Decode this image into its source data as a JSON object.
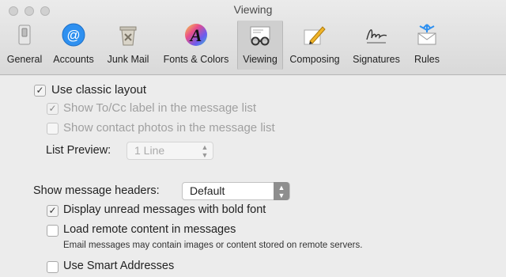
{
  "window": {
    "title": "Viewing"
  },
  "toolbar": {
    "tabs": [
      {
        "label": "General",
        "icon": "general-switch-icon"
      },
      {
        "label": "Accounts",
        "icon": "at-sign-icon"
      },
      {
        "label": "Junk Mail",
        "icon": "trash-bin-icon"
      },
      {
        "label": "Fonts & Colors",
        "icon": "fonts-colors-icon"
      },
      {
        "label": "Viewing",
        "icon": "eyeglasses-icon",
        "selected": true
      },
      {
        "label": "Composing",
        "icon": "pencil-icon"
      },
      {
        "label": "Signatures",
        "icon": "signature-icon"
      },
      {
        "label": "Rules",
        "icon": "rules-envelope-icon"
      }
    ]
  },
  "settings": {
    "classic_layout": {
      "label": "Use classic layout",
      "checked": true
    },
    "show_tocc": {
      "label": "Show To/Cc label in the message list",
      "checked": true,
      "enabled": false
    },
    "show_photos": {
      "label": "Show contact photos in the message list",
      "checked": false,
      "enabled": false
    },
    "list_preview": {
      "label": "List Preview:",
      "value": "1 Line",
      "enabled": false
    },
    "headers": {
      "label": "Show message headers:",
      "value": "Default"
    },
    "bold_unread": {
      "label": "Display unread messages with bold font",
      "checked": true
    },
    "remote_content": {
      "label": "Load remote content in messages",
      "checked": false,
      "note": "Email messages may contain images or content stored on remote servers."
    },
    "smart_addresses": {
      "label": "Use Smart Addresses",
      "checked": false
    }
  },
  "colors": {
    "accent": "#3b86f0",
    "selected_tab": "#cfcfcf"
  }
}
